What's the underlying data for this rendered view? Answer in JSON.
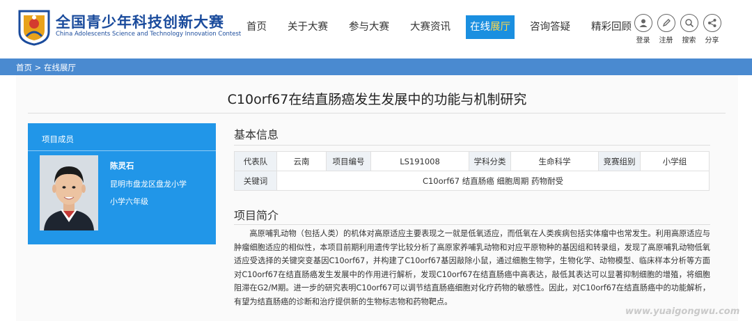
{
  "header": {
    "logo_title": "全国青少年科技创新大赛",
    "logo_subtitle": "China Adolescents Science and Technology Innovation Contest",
    "nav": [
      "首页",
      "关于大赛",
      "参与大赛",
      "大赛资讯",
      "在线展厅",
      "咨询答疑",
      "精彩回顾"
    ],
    "active_nav_parts": [
      "在线",
      "展厅"
    ],
    "tools": [
      {
        "label": "登录",
        "icon": "user-icon"
      },
      {
        "label": "注册",
        "icon": "pencil-icon"
      },
      {
        "label": "搜索",
        "icon": "search-icon"
      },
      {
        "label": "分享",
        "icon": "share-icon"
      }
    ]
  },
  "breadcrumb": "首页 > 在线展厅",
  "page": {
    "title": "C10orf67在结直肠癌发生发展中的功能与机制研究"
  },
  "member": {
    "heading": "项目成员",
    "name": "陈灵石",
    "school": "昆明市盘龙区盘龙小学",
    "grade": "小学六年级"
  },
  "basic_info": {
    "heading": "基本信息",
    "rows": [
      [
        {
          "key": "代表队",
          "value": "云南"
        },
        {
          "key": "项目编号",
          "value": "LS191008"
        },
        {
          "key": "学科分类",
          "value": "生命科学"
        },
        {
          "key": "竞赛组别",
          "value": "小学组"
        }
      ]
    ],
    "keywords_label": "关键词",
    "keywords_value": "C10orf67 结直肠癌 细胞周期 药物耐受"
  },
  "intro": {
    "heading": "项目简介",
    "text": "高原哺乳动物（包括人类）的机体对高原适应主要表现之一就是低氧适应，而低氧在人类疾病包括实体瘤中也常发生。利用高原适应与肿瘤细胞适应的相似性，本项目前期利用遗传学比较分析了高原家养哺乳动物和对应平原物种的基因组和转录组，发现了高原哺乳动物低氧适应受选择的关键突变基因C10orf67，并构建了C10orf67基因敲除小鼠，通过细胞生物学，生物化学、动物模型、临床样本分析等方面对C10orf67在结直肠癌发生发展中的作用进行解析，发现C10orf67在结直肠癌中高表达，敲低其表达可以显著抑制细胞的增殖，将细胞阻滞在G2/M期。进一步的研究表明C10orf67可以调节结直肠癌细胞对化疗药物的敏感性。因此，对C10orf67在结直肠癌中的功能解析，有望为结直肠癌的诊断和治疗提供新的生物标志物和药物靶点。"
  },
  "watermark": "www.yuaigongwu.com",
  "colors": {
    "brand_blue": "#1a4b9c",
    "nav_active": "#1a8fe0",
    "crumb_bar": "#4a8ad0",
    "member_card": "#2196e8"
  }
}
